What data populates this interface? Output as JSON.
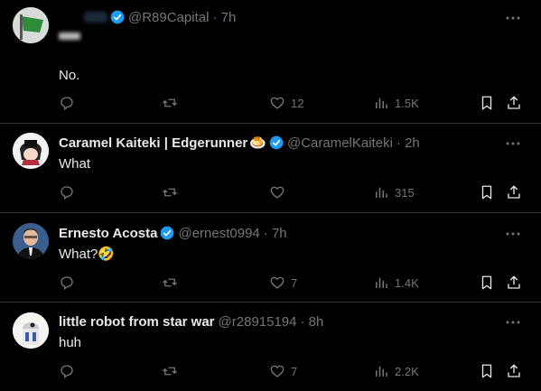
{
  "tweets": [
    {
      "name": "",
      "handle": "@R89Capital",
      "time": "· 7h",
      "body": "No.",
      "replies": "",
      "retweets": "",
      "likes": "12",
      "views": "1.5K",
      "avatar": "green-flag-avatar"
    },
    {
      "name": "Caramel Kaiteki | Edgerunner",
      "name_emoji": "🍮",
      "handle": "@CaramelKaiteki",
      "time": "· 2h",
      "body": "What",
      "replies": "",
      "retweets": "",
      "likes": "",
      "views": "315",
      "avatar": "anime-character-avatar"
    },
    {
      "name": "Ernesto Acosta",
      "handle": "@ernest0994",
      "time": "· 7h",
      "body": "What?",
      "body_emoji": "🤣",
      "replies": "",
      "retweets": "",
      "likes": "7",
      "views": "1.4K",
      "avatar": "man-in-suit-avatar"
    },
    {
      "name": "little robot from star war",
      "handle": "@r28915194",
      "time": "· 8h",
      "body": "huh",
      "replies": "",
      "retweets": "",
      "likes": "7",
      "views": "2.2K",
      "avatar": "r2d2-avatar"
    }
  ],
  "colors": {
    "background": "#000000",
    "text": "#e7e9ea",
    "muted": "#71767b",
    "verified": "#1d9bf0",
    "divider": "#2f3336"
  }
}
